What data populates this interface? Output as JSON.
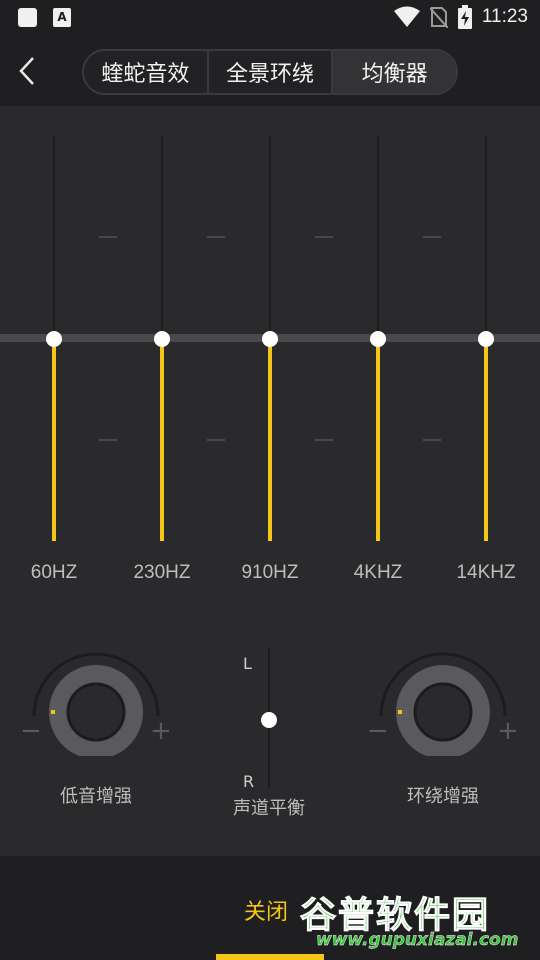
{
  "status_bar": {
    "time": "11:23",
    "icons": [
      "notification-square-icon",
      "text-a-icon",
      "wifi-icon",
      "no-sim-icon",
      "battery-charging-icon"
    ]
  },
  "header": {
    "back_icon": "chevron-left-icon",
    "tabs": [
      {
        "label": "蝰蛇音效",
        "active": false
      },
      {
        "label": "全景环绕",
        "active": false
      },
      {
        "label": "均衡器",
        "active": true
      }
    ]
  },
  "equalizer": {
    "accent_color": "#f6c519",
    "bands": [
      {
        "label": "60HZ",
        "level": 0
      },
      {
        "label": "230HZ",
        "level": 0
      },
      {
        "label": "910HZ",
        "level": 0
      },
      {
        "label": "4KHZ",
        "level": 0
      },
      {
        "label": "14KHZ",
        "level": 0
      }
    ]
  },
  "effects": {
    "bass": {
      "label": "低音增强",
      "minus": "−",
      "plus": "+"
    },
    "balance": {
      "label": "声道平衡",
      "left": "L",
      "right": "R"
    },
    "surround": {
      "label": "环绕增强",
      "minus": "−",
      "plus": "+"
    }
  },
  "bottom": {
    "close_label": "关闭",
    "watermark": {
      "title": "谷普软件园",
      "url": "www.gupuxiazai.com"
    }
  }
}
